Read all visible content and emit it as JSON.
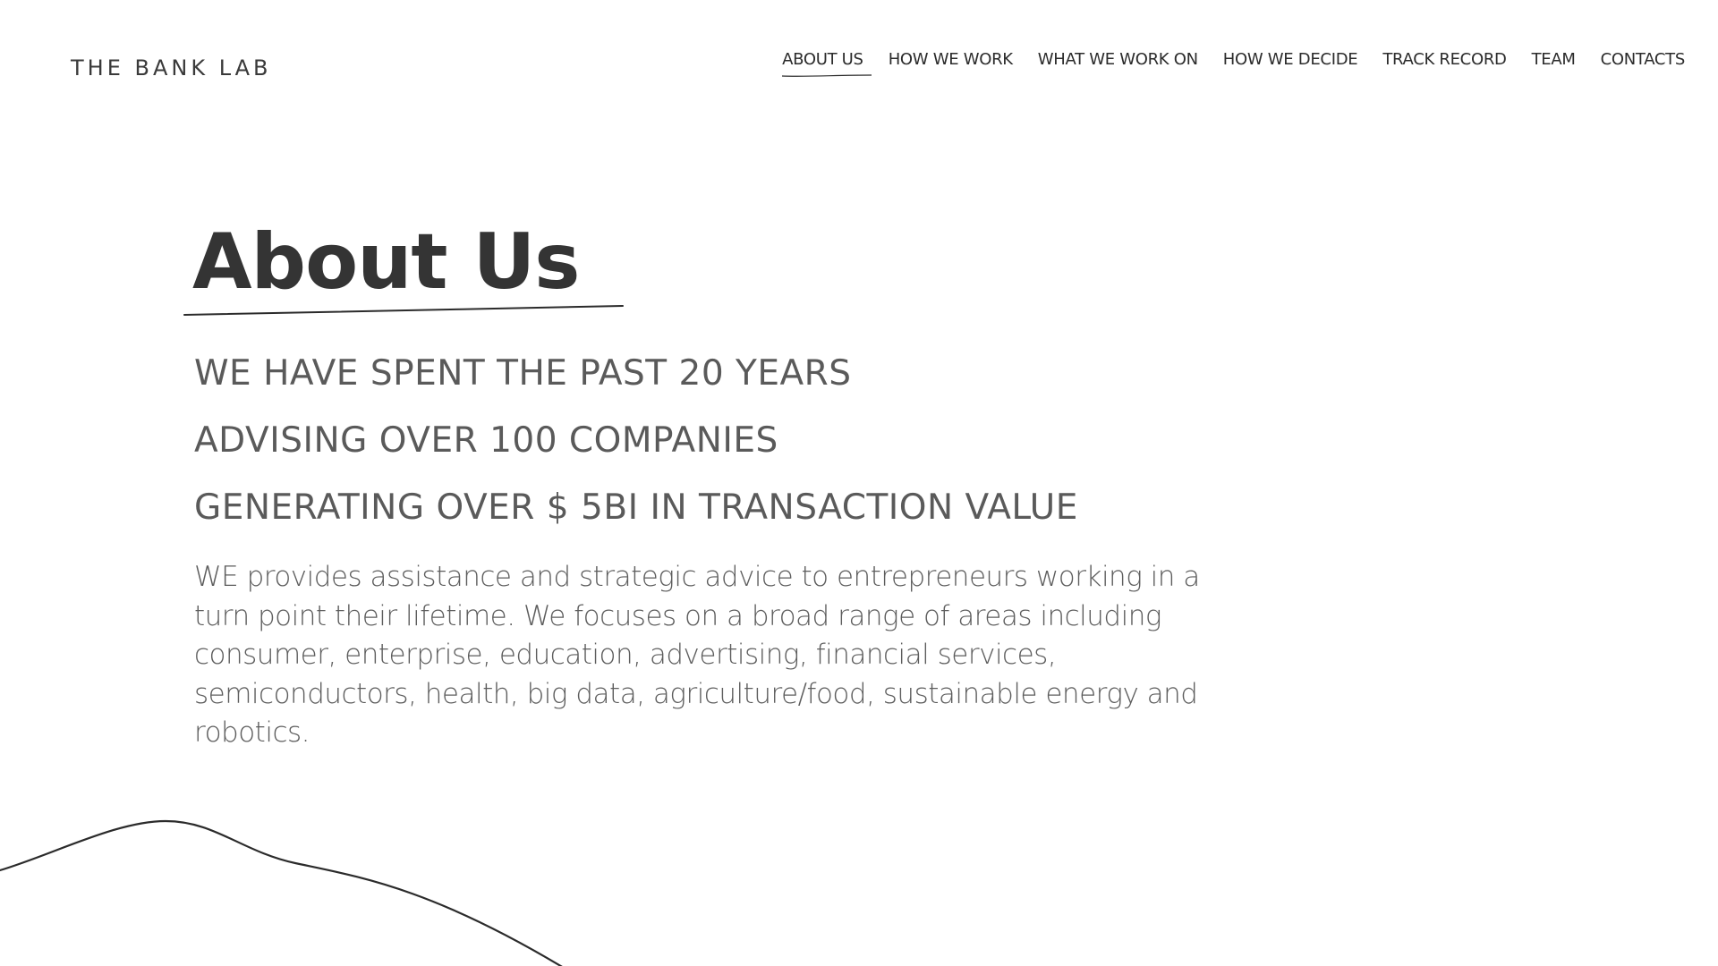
{
  "header": {
    "brand": "THE BANK LAB",
    "nav": [
      {
        "label": "ABOUT US",
        "active": true
      },
      {
        "label": "HOW WE WORK",
        "active": false
      },
      {
        "label": "WHAT WE WORK ON",
        "active": false
      },
      {
        "label": "HOW WE DECIDE",
        "active": false
      },
      {
        "label": "TRACK RECORD",
        "active": false
      },
      {
        "label": "TEAM",
        "active": false
      },
      {
        "label": "CONTACTS",
        "active": false
      }
    ]
  },
  "main": {
    "title": "About Us",
    "stats": [
      "WE HAVE SPENT THE PAST 20 YEARS",
      "ADVISING OVER 100 COMPANIES",
      "GENERATING OVER $ 5BI IN TRANSACTION VALUE"
    ],
    "description": "WE provides assistance and strategic advice to entrepreneurs working in a turn point their lifetime. We focuses on a broad range of areas including consumer, enterprise, education, advertising, financial services, semiconductors, health, big data, agriculture/food, sustainable energy and robotics."
  },
  "colors": {
    "background": "#ffffff",
    "heading": "#343434",
    "text": "#5a5a5a",
    "line": "#2b2b2b"
  }
}
